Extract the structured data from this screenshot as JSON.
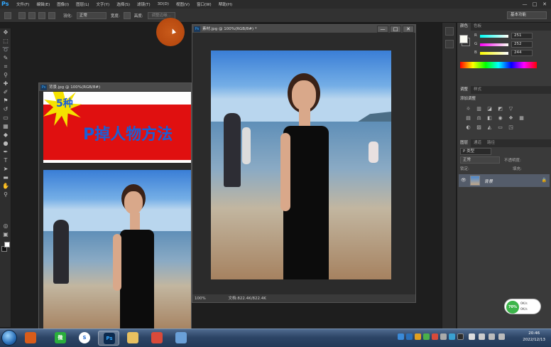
{
  "app": {
    "logo": "Ps"
  },
  "menubar": {
    "items": [
      "文件(F)",
      "编辑(E)",
      "图像(I)",
      "图层(L)",
      "文字(Y)",
      "选择(S)",
      "滤镜(T)",
      "3D(D)",
      "视图(V)",
      "窗口(W)",
      "帮助(H)"
    ],
    "minimize": "—",
    "maximize": "□",
    "close": "✕"
  },
  "options": {
    "feather_label": "羽化:",
    "style_label": "正常",
    "btn_refine": "调整边缘...",
    "width_label": "宽度:",
    "height_label": "高度:",
    "workspace": "基本功能"
  },
  "doc_main": {
    "title": "素材.jpg @ 100%(RGB/8#) *",
    "zoom": "100%",
    "doc_info": "文档:822.4K/822.4K"
  },
  "doc_back": {
    "title": "背景.jpg @ 100%(RGB/8#)",
    "banner_number": "5种",
    "banner_text": "P掉人物方法"
  },
  "color_panel": {
    "tabs": [
      "颜色",
      "色板"
    ],
    "r_label": "R",
    "r_value": "251",
    "g_label": "G",
    "g_value": "252",
    "b_label": "B",
    "b_value": "244",
    "fg_color": "#fbfcf4"
  },
  "adjust_panel": {
    "tabs": [
      "调整",
      "样式"
    ],
    "heading": "添加调整"
  },
  "layers_panel": {
    "tabs": [
      "图层",
      "通道",
      "路径"
    ],
    "kind_label": "P 类型",
    "blend_mode": "正常",
    "opacity_label": "不透明度:",
    "lock_label": "锁定:",
    "fill_label": "填充:",
    "layer_name": "背景"
  },
  "net_meter": {
    "percent": "70%",
    "up": "0K/s",
    "down": "0K/s"
  },
  "taskbar": {
    "time": "20:46",
    "date": "2022/12/13"
  },
  "icons": {
    "ps_app": "Ps",
    "wechat": "微"
  }
}
